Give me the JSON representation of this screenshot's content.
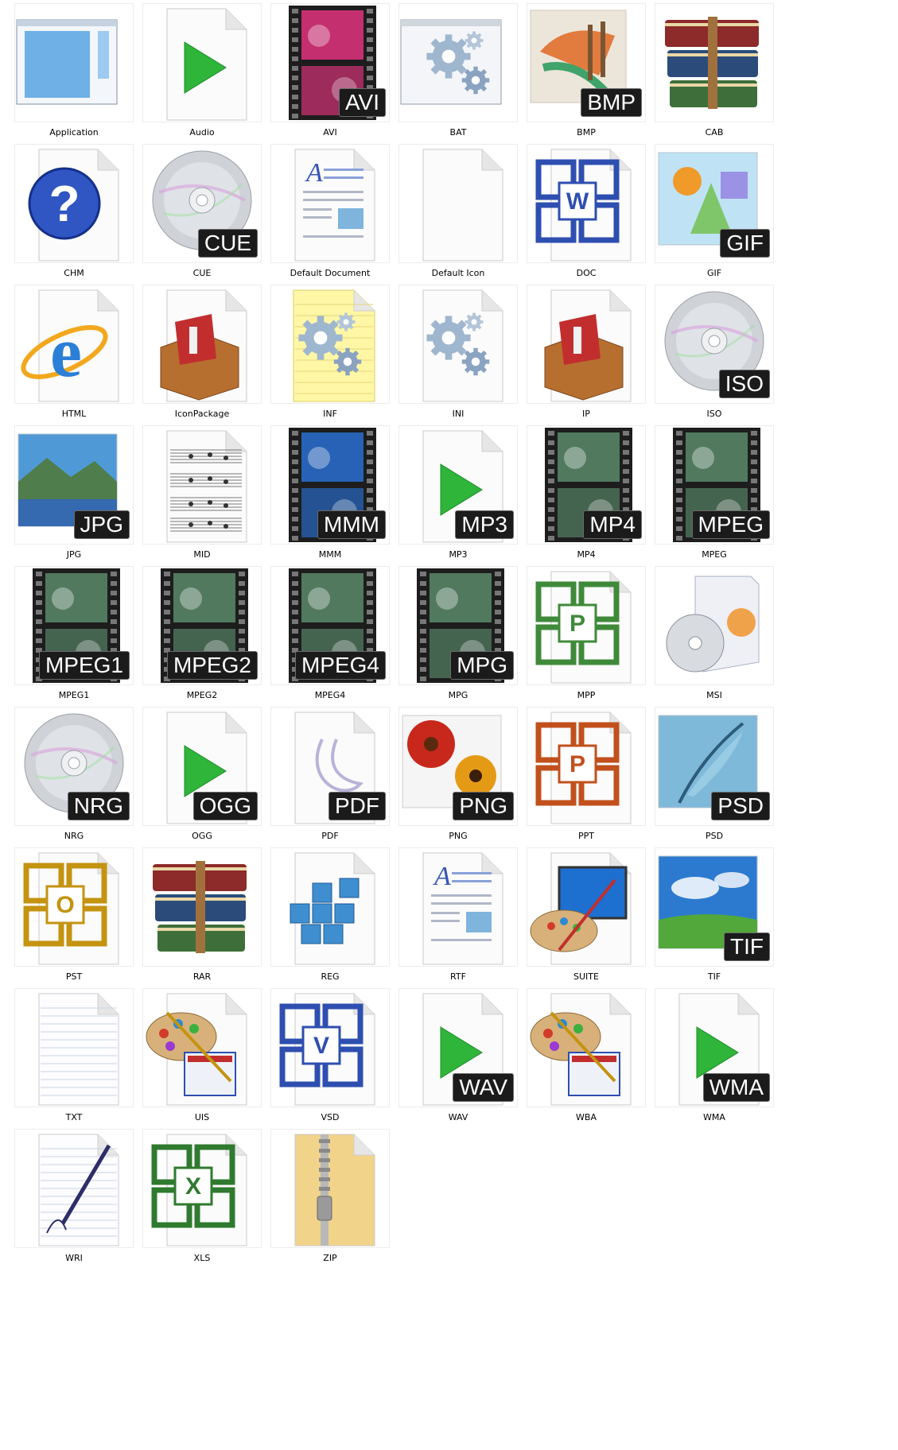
{
  "icons": [
    {
      "label": "Application",
      "kind": "app"
    },
    {
      "label": "Audio",
      "kind": "play"
    },
    {
      "label": "AVI",
      "kind": "film",
      "badge": "AVI",
      "accent": "#e2337e"
    },
    {
      "label": "BAT",
      "kind": "gearwin"
    },
    {
      "label": "BMP",
      "kind": "paint",
      "badge": "BMP"
    },
    {
      "label": "CAB",
      "kind": "books"
    },
    {
      "label": "CHM",
      "kind": "help"
    },
    {
      "label": "CUE",
      "kind": "disc",
      "badge": "CUE"
    },
    {
      "label": "Default Document",
      "kind": "doc"
    },
    {
      "label": "Default Icon",
      "kind": "blank"
    },
    {
      "label": "DOC",
      "kind": "office",
      "color": "#2e4fb0",
      "letter": "W"
    },
    {
      "label": "GIF",
      "kind": "shapes",
      "badge": "GIF"
    },
    {
      "label": "HTML",
      "kind": "ie"
    },
    {
      "label": "IconPackage",
      "kind": "box"
    },
    {
      "label": "INF",
      "kind": "notegear"
    },
    {
      "label": "INI",
      "kind": "pagegear"
    },
    {
      "label": "IP",
      "kind": "box"
    },
    {
      "label": "ISO",
      "kind": "disc",
      "badge": "ISO"
    },
    {
      "label": "JPG",
      "kind": "landscape",
      "badge": "JPG"
    },
    {
      "label": "MID",
      "kind": "music"
    },
    {
      "label": "MMM",
      "kind": "film",
      "badge": "MMM",
      "accent": "#2a6fd1"
    },
    {
      "label": "MP3",
      "kind": "play",
      "badge": "MP3"
    },
    {
      "label": "MP4",
      "kind": "film",
      "badge": "MP4",
      "accent": "#5a8a6a"
    },
    {
      "label": "MPEG",
      "kind": "film",
      "badge": "MPEG",
      "accent": "#5a8a6a"
    },
    {
      "label": "MPEG1",
      "kind": "film",
      "badge": "MPEG1",
      "accent": "#5a8a6a"
    },
    {
      "label": "MPEG2",
      "kind": "film",
      "badge": "MPEG2",
      "accent": "#5a8a6a"
    },
    {
      "label": "MPEG4",
      "kind": "film",
      "badge": "MPEG4",
      "accent": "#5a8a6a"
    },
    {
      "label": "MPG",
      "kind": "film",
      "badge": "MPG",
      "accent": "#5a8a6a"
    },
    {
      "label": "MPP",
      "kind": "office",
      "color": "#3f8a3a",
      "letter": "P"
    },
    {
      "label": "MSI",
      "kind": "installer"
    },
    {
      "label": "NRG",
      "kind": "disc",
      "badge": "NRG"
    },
    {
      "label": "OGG",
      "kind": "play",
      "badge": "OGG"
    },
    {
      "label": "PDF",
      "kind": "pdf",
      "badge": "PDF"
    },
    {
      "label": "PNG",
      "kind": "flower",
      "badge": "PNG"
    },
    {
      "label": "PPT",
      "kind": "office",
      "color": "#c1501c",
      "letter": "P"
    },
    {
      "label": "PSD",
      "kind": "feather",
      "badge": "PSD"
    },
    {
      "label": "PST",
      "kind": "office",
      "color": "#c49310",
      "letter": "O"
    },
    {
      "label": "RAR",
      "kind": "books"
    },
    {
      "label": "REG",
      "kind": "cubes"
    },
    {
      "label": "RTF",
      "kind": "doc"
    },
    {
      "label": "SUITE",
      "kind": "monitor"
    },
    {
      "label": "TIF",
      "kind": "sky",
      "badge": "TIF"
    },
    {
      "label": "TXT",
      "kind": "lined"
    },
    {
      "label": "UIS",
      "kind": "palette"
    },
    {
      "label": "VSD",
      "kind": "office",
      "color": "#2e4fb0",
      "letter": "V"
    },
    {
      "label": "WAV",
      "kind": "play",
      "badge": "WAV"
    },
    {
      "label": "WBA",
      "kind": "palette"
    },
    {
      "label": "WMA",
      "kind": "play",
      "badge": "WMA"
    },
    {
      "label": "WRI",
      "kind": "pen"
    },
    {
      "label": "XLS",
      "kind": "office",
      "color": "#2f7a2f",
      "letter": "X"
    },
    {
      "label": "ZIP",
      "kind": "folder"
    }
  ]
}
